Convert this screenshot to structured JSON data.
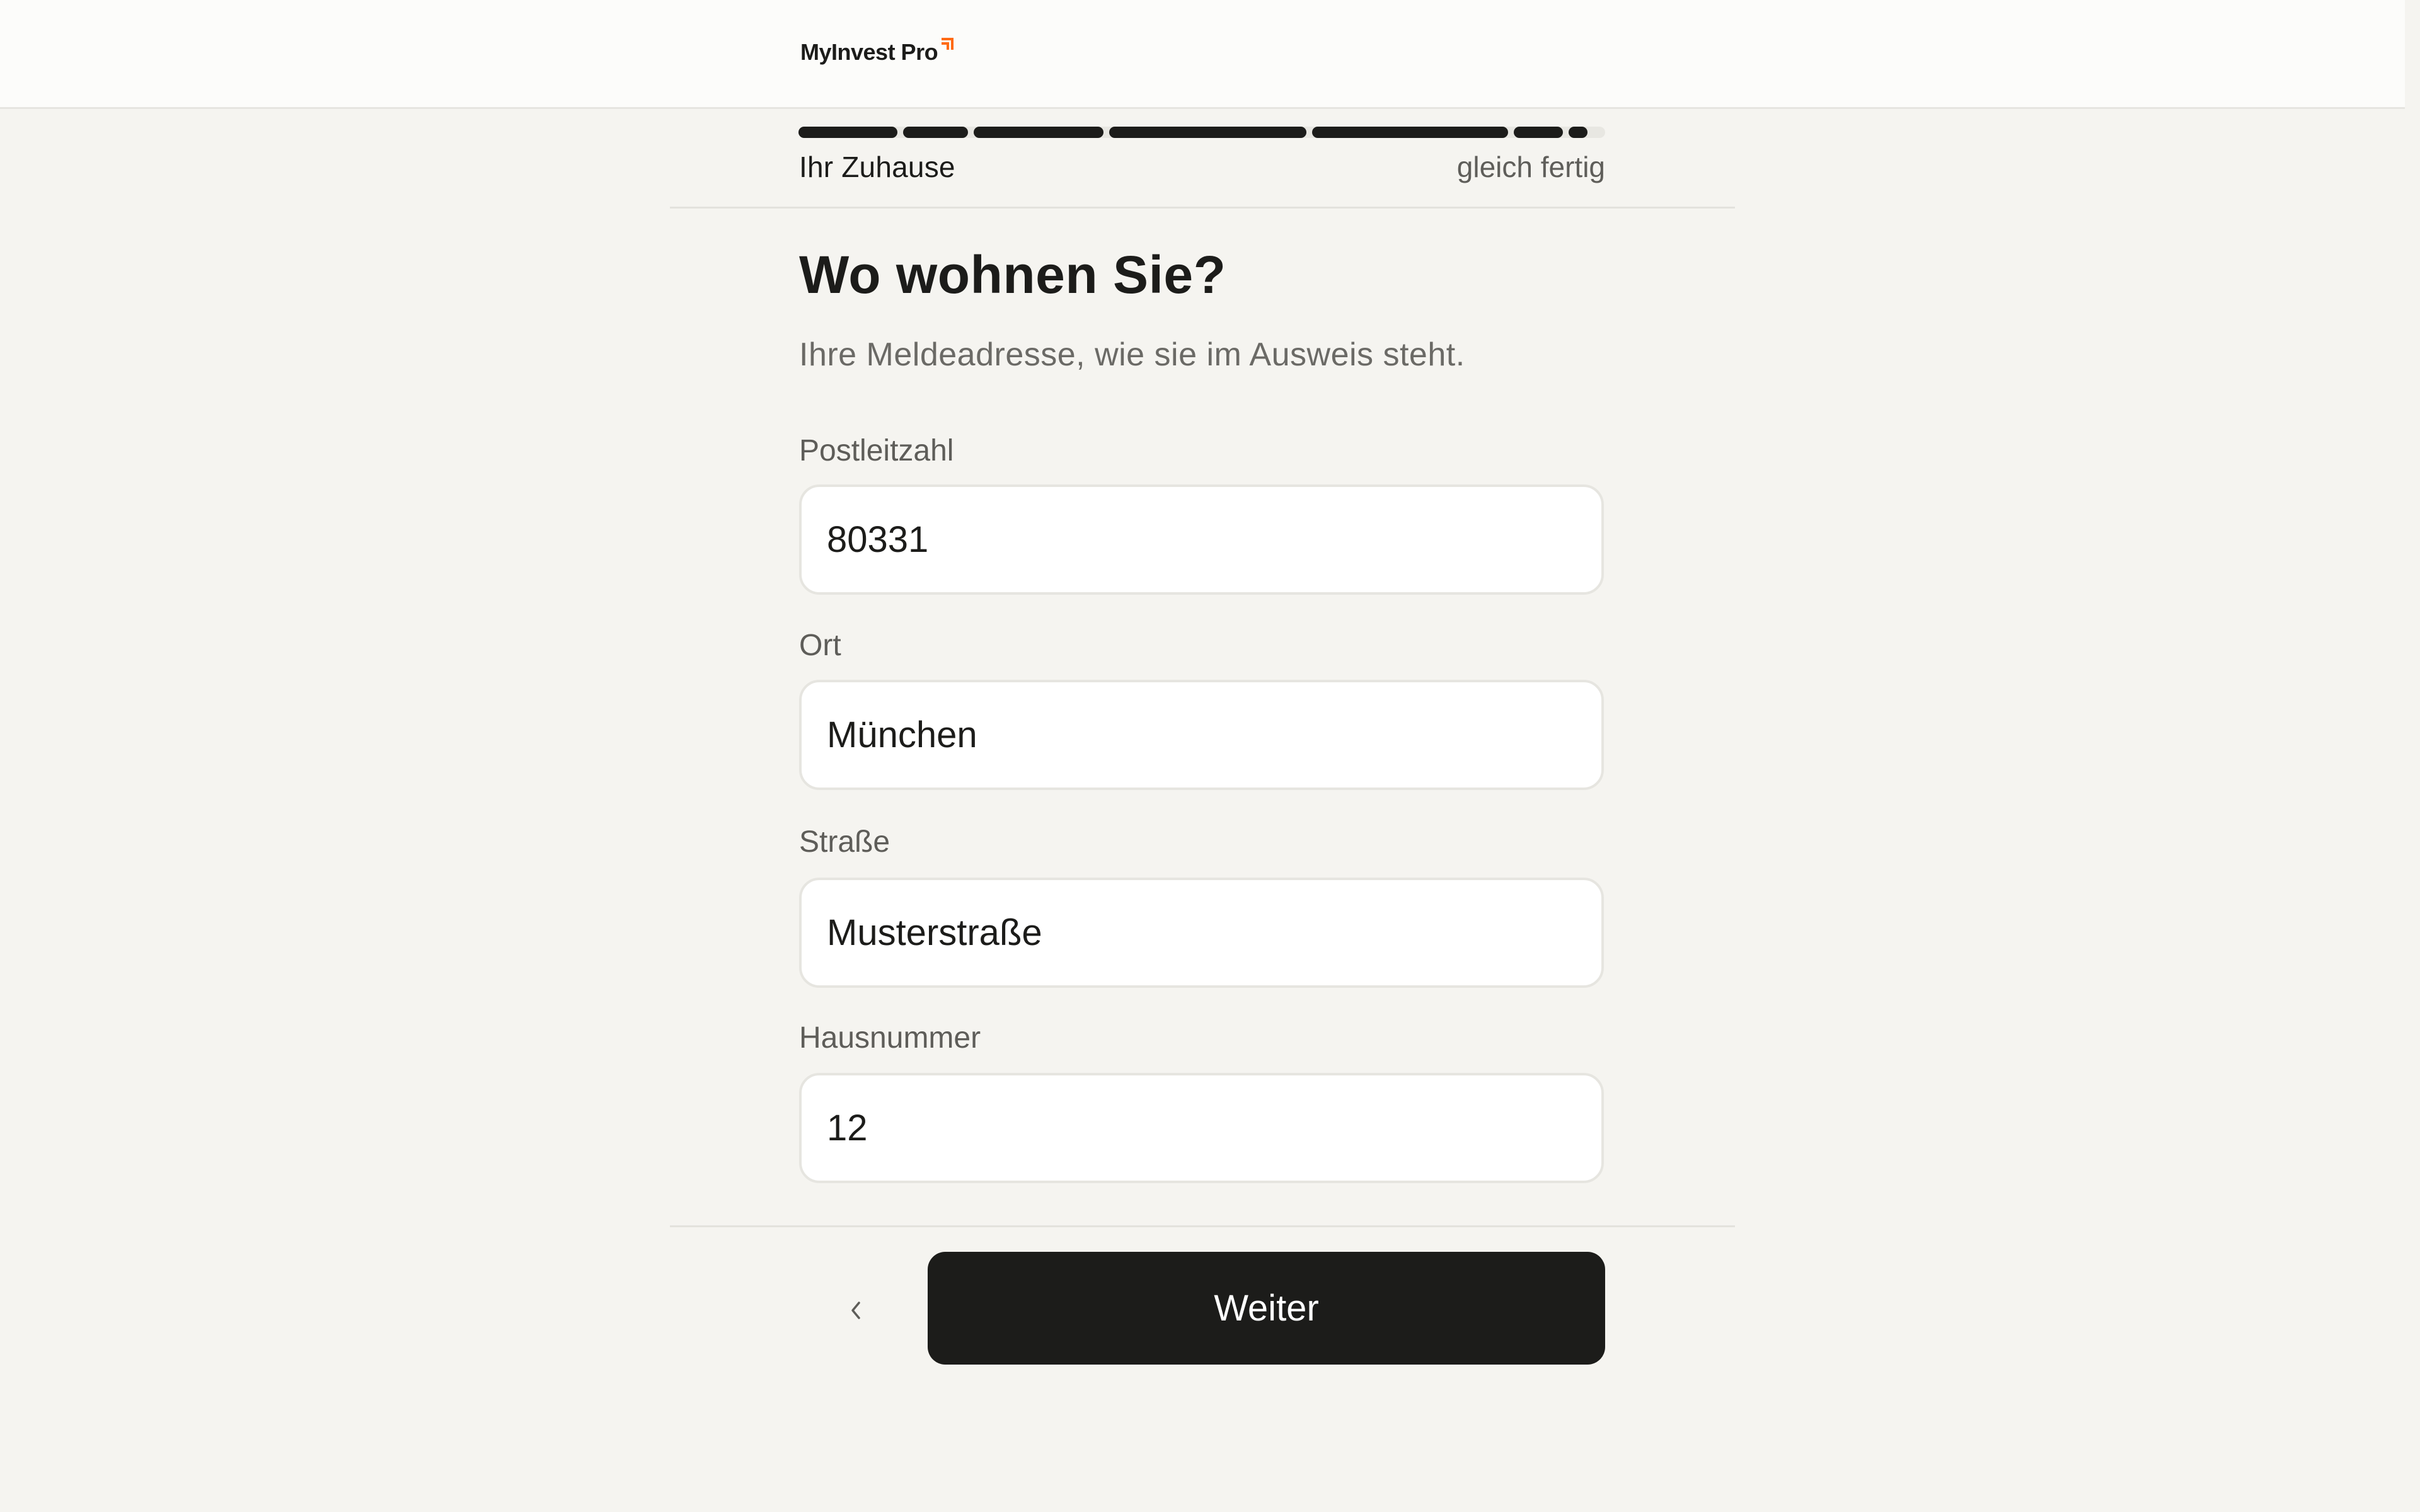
{
  "header": {
    "logo_text": "MyInvest Pro",
    "logo_icon": "arrow-up-right-icon",
    "accent_color": "#ff6a13"
  },
  "progress": {
    "step_label": "Ihr Zuhause",
    "status": "gleich fertig",
    "completion_fraction": 0.98
  },
  "form": {
    "title": "Wo wohnen Sie?",
    "subtitle": "Ihre Meldeadresse, wie sie im Ausweis steht.",
    "fields": [
      {
        "label": "Postleitzahl",
        "value": "80331"
      },
      {
        "label": "Ort",
        "value": "München"
      },
      {
        "label": "Straße",
        "value": "Musterstraße"
      },
      {
        "label": "Hausnummer",
        "value": "12"
      }
    ]
  },
  "footer": {
    "back_icon": "chevron-left-icon",
    "next_label": "Weiter"
  },
  "colors": {
    "background": "#f5f4f0",
    "primary": "#1c1c1a",
    "muted_text": "#6b6a66"
  }
}
